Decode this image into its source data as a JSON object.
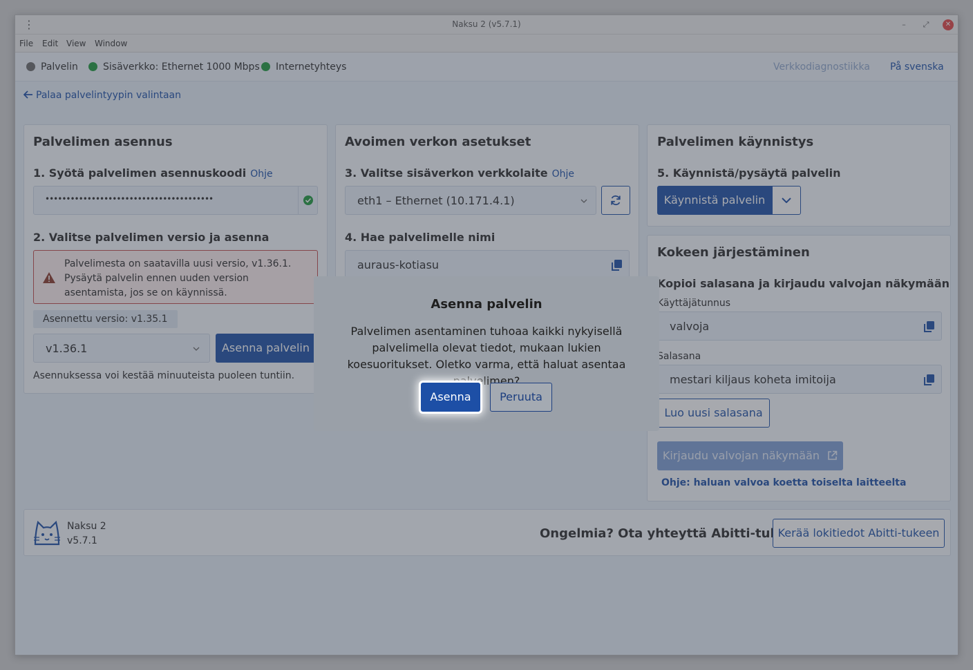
{
  "window": {
    "title": "Naksu 2 (v5.7.1)",
    "menu": [
      "File",
      "Edit",
      "View",
      "Window"
    ]
  },
  "status": {
    "server": "Palvelin",
    "lan": "Sisäverkko: Ethernet 1000 Mbps",
    "internet": "Internetyhteys",
    "diagnostics_link": "Verkkodiagnostiikka",
    "language_link": "På svenska"
  },
  "back_link": "Palaa palvelintyypin valintaan",
  "install_panel": {
    "title": "Palvelimen asennus",
    "step1": "1. Syötä palvelimen asennuskoodi",
    "step1_help": "Ohje",
    "code_masked": "••••••••••••••••••••••••••••••••••••••••",
    "step2": "2. Valitse palvelimen versio ja asenna",
    "warning": "Palvelimesta on saatavilla uusi versio, v1.36.1. Pysäytä palvelin ennen uuden version asentamista, jos se on käynnissä.",
    "installed_version": "Asennettu versio: v1.35.1",
    "version_select": "v1.36.1",
    "install_button": "Asenna palvelin",
    "note": "Asennuksessa voi kestää minuuteista puoleen tuntiin."
  },
  "network_panel": {
    "title": "Avoimen verkon asetukset",
    "step3": "3. Valitse sisäverkon verkkolaite",
    "step3_help": "Ohje",
    "device_select": "eth1 – Ethernet (10.171.4.1)",
    "step4": "4. Hae palvelimelle nimi",
    "server_name": "auraus-kotiasu"
  },
  "start_panel": {
    "title": "Palvelimen käynnistys",
    "step5": "5. Käynnistä/pysäytä palvelin",
    "start_button": "Käynnistä palvelin"
  },
  "exam_panel": {
    "title": "Kokeen järjestäminen",
    "subtitle": "Kopioi salasana ja kirjaudu valvojan näkymään",
    "username_label": "Käyttäjätunnus",
    "username": "valvoja",
    "password_label": "Salasana",
    "password": "mestari kiljaus koheta imitoija",
    "new_password_button": "Luo uusi salasana",
    "login_button": "Kirjaudu valvojan näkymään",
    "help_link": "Ohje: haluan valvoa koetta toiselta laitteelta"
  },
  "footer": {
    "app_name": "Naksu 2",
    "app_version": "v5.7.1",
    "support_text": "Ongelmia? Ota yhteyttä Abitti-tukeen",
    "logs_button": "Kerää lokitiedot Abitti-tukeen"
  },
  "modal": {
    "title": "Asenna palvelin",
    "body": "Palvelimen asentaminen tuhoaa kaikki nykyisellä palvelimella olevat tiedot, mukaan lukien koesuoritukset. Oletko varma, että haluat asentaa palvelimen?",
    "confirm": "Asenna",
    "cancel": "Peruuta"
  }
}
